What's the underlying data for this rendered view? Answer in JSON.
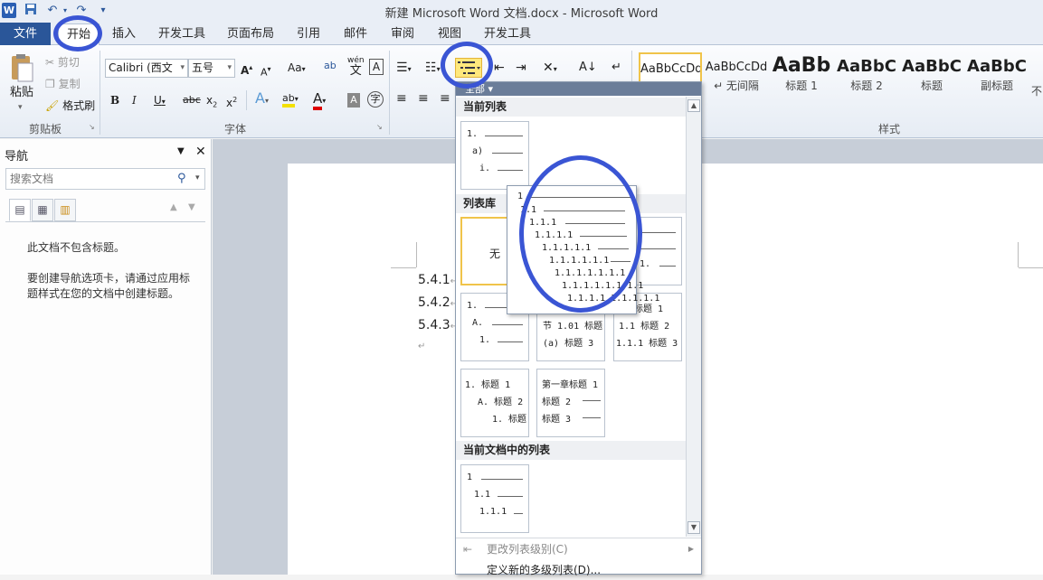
{
  "window": {
    "title": "新建 Microsoft Word 文档.docx - Microsoft Word"
  },
  "quick_access": {
    "logo": "W",
    "icons": [
      "save-icon",
      "undo-icon",
      "redo-icon",
      "customize-icon"
    ]
  },
  "tabs": [
    {
      "label": "文件"
    },
    {
      "label": "开始"
    },
    {
      "label": "插入"
    },
    {
      "label": "开发工具"
    },
    {
      "label": "页面布局"
    },
    {
      "label": "引用"
    },
    {
      "label": "邮件"
    },
    {
      "label": "审阅"
    },
    {
      "label": "视图"
    },
    {
      "label": "开发工具"
    }
  ],
  "clipboard": {
    "paste": "粘贴",
    "cut": "剪切",
    "copy": "复制",
    "format_painter": "格式刷",
    "group": "剪贴板"
  },
  "font": {
    "name": "Calibri (西文",
    "size": "五号",
    "group": "字体",
    "change_case": "Aa",
    "phonetic_top": "wén",
    "phonetic": "文",
    "box": "A"
  },
  "styles": {
    "group": "样式",
    "items": [
      {
        "sample": "AaBbCcDd",
        "name": ""
      },
      {
        "sample": "AaBbCcDd",
        "name": "↵ 无间隔"
      },
      {
        "sample": "AaBb",
        "name": "标题 1"
      },
      {
        "sample": "AaBbC",
        "name": "标题 2"
      },
      {
        "sample": "AaBbC",
        "name": "标题"
      },
      {
        "sample": "AaBbC",
        "name": "副标题"
      },
      {
        "sample": "",
        "name": "不"
      }
    ]
  },
  "navigation": {
    "title": "导航",
    "search_placeholder": "搜索文档",
    "message1": "此文档不包含标题。",
    "message2": "要创建导航选项卡，请通过应用标题样式在您的文档中创建标题。"
  },
  "document": {
    "headings": [
      "5.4.1",
      "5.4.2",
      "5.4.3"
    ]
  },
  "dropdown": {
    "filter": "全部 ▾",
    "section_current": "当前列表",
    "section_library": "列表库",
    "section_doc": "当前文档中的列表",
    "none_label": "无",
    "cmd_change_level": "更改列表级别(C)",
    "cmd_define_new": "定义新的多级列表(D)...",
    "current_list_lines": [
      "1.",
      "a)",
      "i."
    ],
    "lib_thumb1": [
      "1.",
      "A.",
      "1."
    ],
    "lib_thumb2": [
      "节 1.01 标题",
      "(a) 标题 3"
    ],
    "lib_thumb3": [
      "1.1 标题 2",
      "1.1.1 标题 3"
    ],
    "lib_thumb3_top": "标题 1",
    "lib_thumb4": [
      "1. 标题 1",
      "A. 标题 2",
      "1. 标题"
    ],
    "lib_thumb5": [
      "第一章标题 1",
      "标题 2",
      "标题 3"
    ],
    "doc_thumb": [
      "1",
      "1.1",
      "1.1.1"
    ],
    "lib_partial": [
      "1."
    ]
  },
  "tooltip": {
    "lines": [
      "1",
      "1.1",
      "1.1.1",
      "1.1.1.1",
      "1.1.1.1.1",
      "1.1.1.1.1.1",
      "1.1.1.1.1.1.1",
      "1.1.1.1.1.1.1.1",
      "1.1.1.1.1.1.1.1.1"
    ]
  },
  "colors": {
    "file_tab": "#2a5699",
    "annotation": "#3a55d4",
    "highlight": "#ffe87c"
  }
}
